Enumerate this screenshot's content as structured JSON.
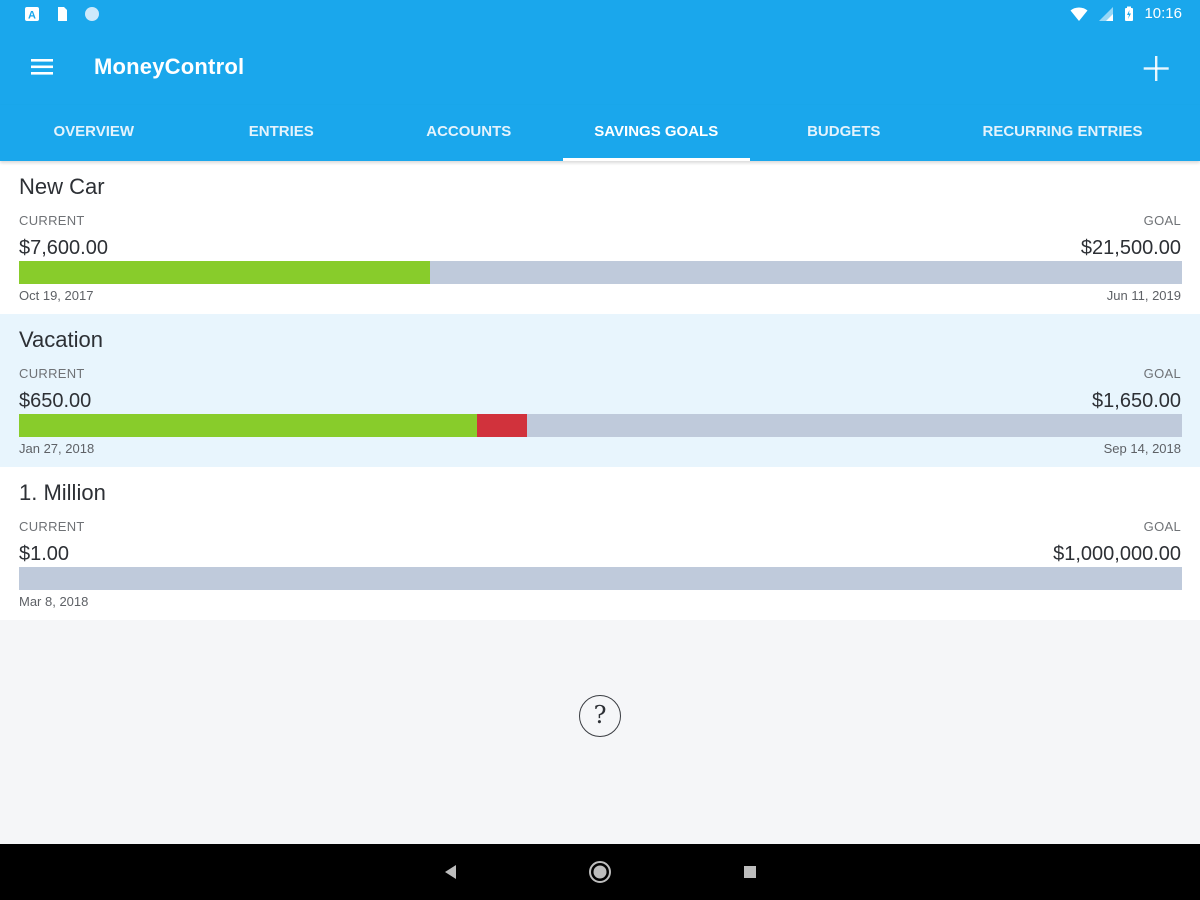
{
  "status_bar": {
    "left_icons": [
      "a-icon",
      "sd-card-icon",
      "circle-icon"
    ],
    "right_icons": [
      "wifi-icon",
      "signal-icon",
      "battery-icon"
    ],
    "time": "10:16"
  },
  "toolbar": {
    "title": "MoneyControl",
    "menu_icon": "hamburger-menu-icon",
    "add_icon": "plus-icon"
  },
  "tabs": [
    {
      "label": "OVERVIEW",
      "active": false
    },
    {
      "label": "ENTRIES",
      "active": false
    },
    {
      "label": "ACCOUNTS",
      "active": false
    },
    {
      "label": "SAVINGS GOALS",
      "active": true
    },
    {
      "label": "BUDGETS",
      "active": false
    },
    {
      "label": "RECURRING ENTRIES",
      "active": false
    }
  ],
  "goals": [
    {
      "name": "New Car",
      "current_label": "CURRENT",
      "goal_label": "GOAL",
      "current": "$7,600.00",
      "goal": "$21,500.00",
      "progress": 0.353,
      "overdue_until": null,
      "start_date": "Oct 19, 2017",
      "end_date": "Jun 11, 2019"
    },
    {
      "name": "Vacation",
      "current_label": "CURRENT",
      "goal_label": "GOAL",
      "current": "$650.00",
      "goal": "$1,650.00",
      "progress": 0.394,
      "overdue_until": 0.437,
      "start_date": "Jan 27, 2018",
      "end_date": "Sep 14, 2018"
    },
    {
      "name": "1. Million",
      "current_label": "CURRENT",
      "goal_label": "GOAL",
      "current": "$1.00",
      "goal": "$1,000,000.00",
      "progress": 1e-06,
      "overdue_until": null,
      "start_date": "Mar 8, 2018",
      "end_date": ""
    }
  ],
  "help": {
    "symbol": "?",
    "icon": "question-circle-icon"
  },
  "nav": {
    "back_icon": "back-triangle-icon",
    "home_icon": "home-circle-icon",
    "recent_icon": "recent-square-icon"
  },
  "colors": {
    "primary": "#1aa7ec",
    "progress": "#88cc2b",
    "overdue": "#d1323c",
    "track": "#bfcadb",
    "alt_row": "#e8f5fd"
  }
}
